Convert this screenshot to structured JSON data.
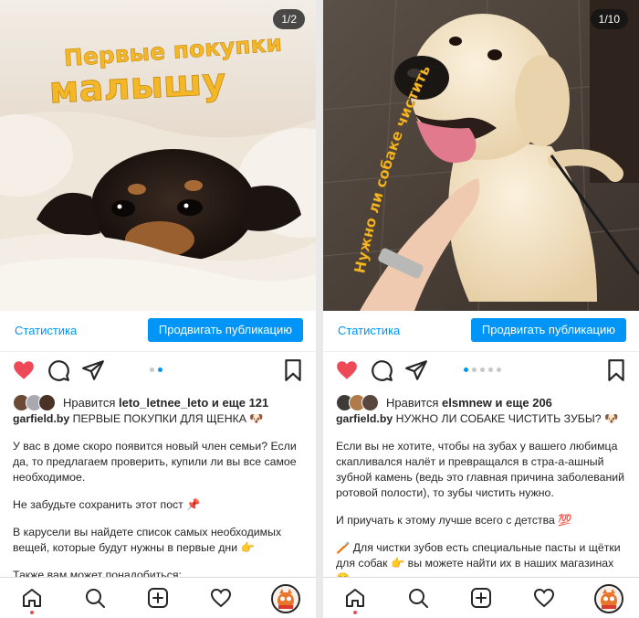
{
  "left": {
    "counter": "1/2",
    "overlay_line1": "Первые покупки",
    "overlay_line2": "малышу",
    "stats_label": "Статистика",
    "promote_label": "Продвигать публикацию",
    "likes_prefix": "Нравится",
    "likes_user": "leto_letnee_leto",
    "likes_and": "и еще",
    "likes_count": "121",
    "username": "garfield.by",
    "caption_title": "ПЕРВЫЕ ПОКУПКИ ДЛЯ ЩЕНКА 🐶",
    "paragraphs": [
      "У вас в доме скоро появится новый член семьи? Если да, то предлагаем проверить, купили ли вы все самое необходимое.",
      "Не забудьте сохранить этот пост 📌",
      "В карусели вы найдете список самых необходимых вещей, которые будут нужны в первые дни 👉",
      "Также вам может понадобиться:"
    ],
    "carousel_total": 2,
    "carousel_active": 2
  },
  "right": {
    "counter": "1/10",
    "overlay_text": "Нужно ли собаке чистить зубы?",
    "stats_label": "Статистика",
    "promote_label": "Продвигать публикацию",
    "likes_prefix": "Нравится",
    "likes_user": "elsmnew",
    "likes_and": "и еще",
    "likes_count": "206",
    "username": "garfield.by",
    "caption_title": "НУЖНО ЛИ СОБАКЕ ЧИСТИТЬ ЗУБЫ? 🐶",
    "paragraphs": [
      "Если вы не хотите, чтобы на зубах у вашего любимца скапливался налёт и превращался в стра-а-ашный зубной камень (ведь это главная причина заболеваний ротовой полости), то зубы чистить нужно.",
      "И приучать к этому лучше всего с детства 💯",
      "🪥 Для чистки зубов есть специальные пасты и щётки для собак 👉 вы можете найти их в наших магазинах 😋"
    ],
    "carousel_total": 5,
    "carousel_active": 1
  },
  "colors": {
    "accent": "#0095f6",
    "like_red": "#ed4956",
    "overlay_yellow": "#f4b728"
  },
  "icons": [
    "heart-icon",
    "comment-icon",
    "share-icon",
    "bookmark-icon",
    "home-icon",
    "search-icon",
    "add-icon",
    "activity-icon",
    "profile-avatar"
  ]
}
